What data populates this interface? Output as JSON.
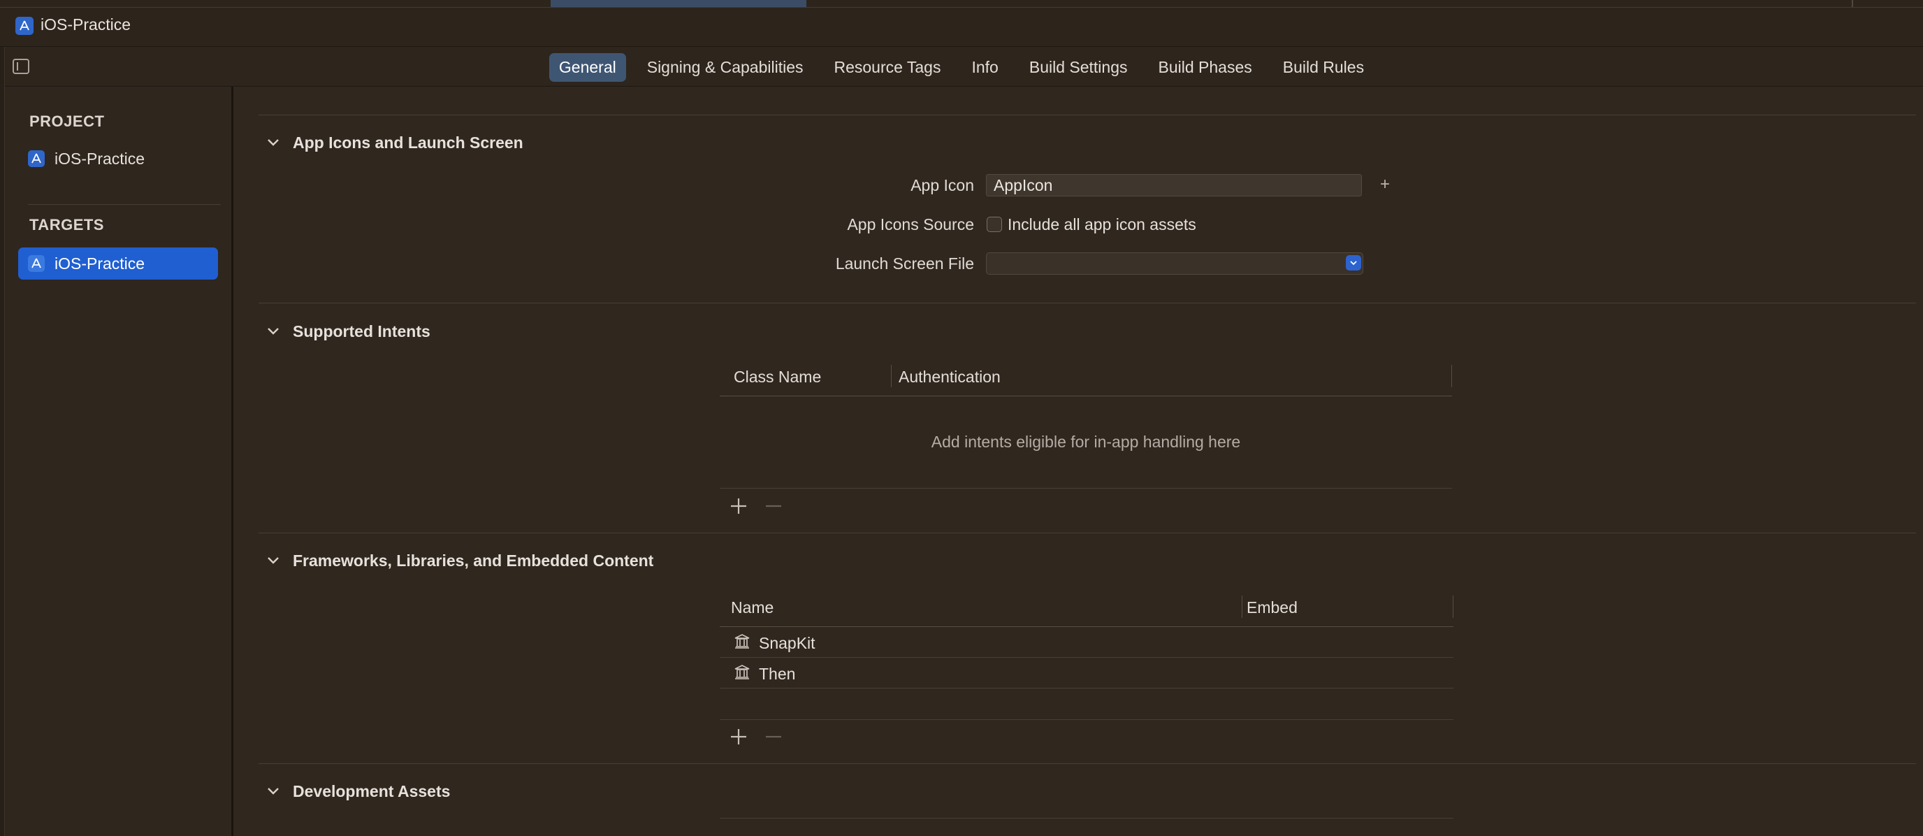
{
  "window": {
    "title": "iOS-Practice",
    "icon": "xcode-app-icon"
  },
  "tabs": [
    {
      "label": "General",
      "active": true
    },
    {
      "label": "Signing & Capabilities",
      "active": false
    },
    {
      "label": "Resource Tags",
      "active": false
    },
    {
      "label": "Info",
      "active": false
    },
    {
      "label": "Build Settings",
      "active": false
    },
    {
      "label": "Build Phases",
      "active": false
    },
    {
      "label": "Build Rules",
      "active": false
    }
  ],
  "sidebar": {
    "project_heading": "PROJECT",
    "project_item": "iOS-Practice",
    "targets_heading": "TARGETS",
    "target_item": "iOS-Practice"
  },
  "app_icons": {
    "title": "App Icons and Launch Screen",
    "app_icon_label": "App Icon",
    "app_icon_value": "AppIcon",
    "add_symbol": "+",
    "source_label": "App Icons Source",
    "source_checkbox_label": "Include all app icon assets",
    "launch_label": "Launch Screen File",
    "launch_value": ""
  },
  "intents": {
    "title": "Supported Intents",
    "col_class": "Class Name",
    "col_auth": "Authentication",
    "empty_message": "Add intents eligible for in-app handling here"
  },
  "frameworks": {
    "title": "Frameworks, Libraries, and Embedded Content",
    "col_name": "Name",
    "col_embed": "Embed",
    "rows": [
      {
        "name": "SnapKit",
        "embed": ""
      },
      {
        "name": "Then",
        "embed": ""
      }
    ]
  },
  "dev_assets": {
    "title": "Development Assets"
  },
  "colors": {
    "accent": "#1f5fd1",
    "tab_active": "#3f5673",
    "background": "#30271f"
  }
}
